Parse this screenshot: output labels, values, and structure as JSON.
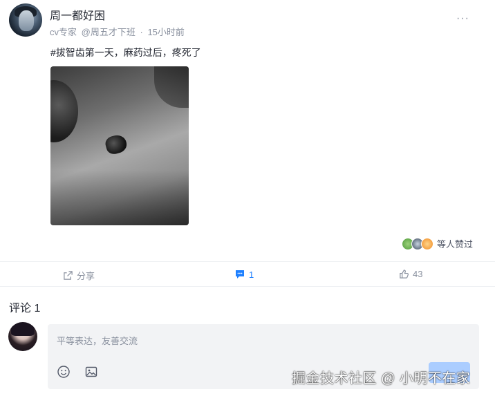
{
  "post": {
    "username": "周一都好困",
    "title_tag": "cv专家",
    "company": "@周五才下班",
    "separator": "·",
    "time": "15小时前",
    "more": "···",
    "text": "#拔智齿第一天，麻药过后，疼死了",
    "likers_text": "等人赞过"
  },
  "actions": {
    "share_label": "分享",
    "comment_count": "1",
    "like_count": "43"
  },
  "comments": {
    "title": "评论 1",
    "placeholder": "平等表达，友善交流"
  },
  "watermark": "掘金技术社区 @ 小明不在家",
  "colors": {
    "accent": "#1e80ff",
    "muted": "#8a919f",
    "input_bg": "#f2f3f5"
  },
  "icons": {
    "share": "share-icon",
    "comment": "comment-icon",
    "like": "thumbs-up-icon",
    "emoji": "emoji-icon",
    "image": "image-icon",
    "more": "more-icon"
  }
}
